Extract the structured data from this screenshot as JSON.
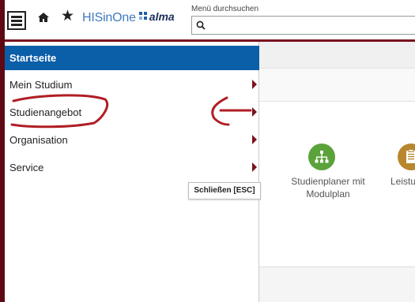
{
  "header": {
    "logo_text": "HISinOne",
    "logo_sub": "alma",
    "search_label": "Menü durchsuchen",
    "search_value": "",
    "search_placeholder": ""
  },
  "menu": {
    "home_label": "Startseite",
    "items": [
      {
        "label": "Mein Studium"
      },
      {
        "label": "Studienangebot"
      },
      {
        "label": "Organisation"
      },
      {
        "label": "Service"
      }
    ],
    "close_label": "Schließen [ESC]"
  },
  "apps": [
    {
      "label": "Studienplaner mit Modulplan",
      "icon": "sitemap-icon"
    },
    {
      "label": "Leistur",
      "icon": "clipboard-icon"
    }
  ],
  "colors": {
    "brand_red": "#7a1220",
    "menu_active_bg": "#0b5ea8",
    "chevron": "#7a1220",
    "annotation": "#b01e24"
  }
}
